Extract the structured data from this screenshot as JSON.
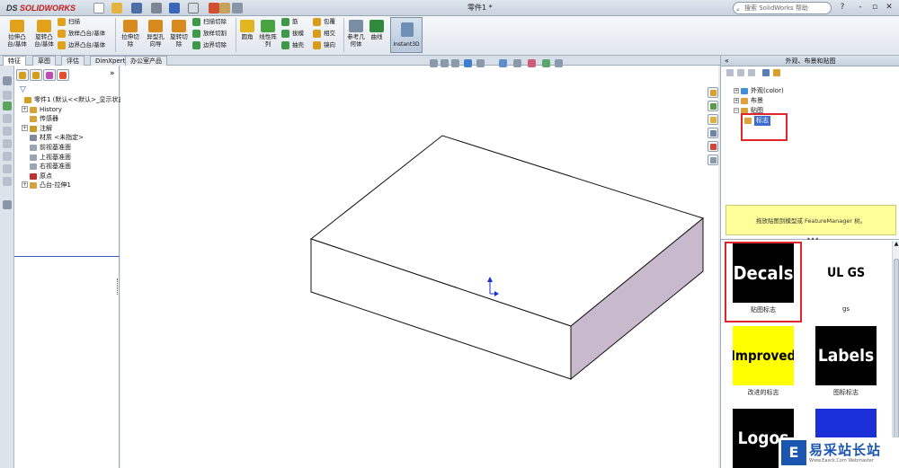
{
  "app": {
    "logo_prefix": "DS",
    "logo_text": "SOLIDWORKS",
    "document_title": "零件1 *",
    "search_placeholder": "搜索 SolidWorks 帮助",
    "window_buttons": [
      "?",
      "-",
      "▫",
      "✕"
    ]
  },
  "ribbon": {
    "big_buttons": [
      {
        "id": "extrude-boss",
        "label": "拉伸凸\n台/基体",
        "color": "#e0a21a"
      },
      {
        "id": "revolve-boss",
        "label": "旋转凸\n台/基体",
        "color": "#e0a21a"
      },
      {
        "id": "extrude-cut",
        "label": "拉伸切\n除",
        "color": "#d98a1c"
      },
      {
        "id": "hole-wizard",
        "label": "异型孔\n向导",
        "color": "#d98a1c"
      },
      {
        "id": "revolve-cut",
        "label": "旋转切\n除",
        "color": "#d98a1c"
      },
      {
        "id": "fillet",
        "label": "圆角",
        "color": "#e3b51e"
      },
      {
        "id": "linear-pattern",
        "label": "线性阵\n列",
        "color": "#49a340"
      },
      {
        "id": "ref-geometry",
        "label": "参考几\n何体",
        "color": "#7a8da3"
      },
      {
        "id": "curves",
        "label": "曲线",
        "color": "#2f8a3c"
      }
    ],
    "small_buttons": [
      {
        "id": "sweep",
        "label": "扫描",
        "color": "#e0a21a"
      },
      {
        "id": "loft-boss",
        "label": "放样凸台/基体",
        "color": "#e0a21a"
      },
      {
        "id": "boundary-boss",
        "label": "边界凸台/基体",
        "color": "#e0a21a"
      },
      {
        "id": "swept-cut",
        "label": "扫描切除",
        "color": "#3e9a48"
      },
      {
        "id": "lofted-cut",
        "label": "放样切割",
        "color": "#3e9a48"
      },
      {
        "id": "boundary-cut",
        "label": "边界切除",
        "color": "#3e9a48"
      },
      {
        "id": "rib",
        "label": "筋",
        "color": "#3e9a48"
      },
      {
        "id": "draft",
        "label": "拔模",
        "color": "#3e9a48"
      },
      {
        "id": "shell",
        "label": "抽壳",
        "color": "#3e9a48"
      },
      {
        "id": "wrap",
        "label": "包覆",
        "color": "#d99b1a"
      },
      {
        "id": "intersect",
        "label": "相交",
        "color": "#d99b1a"
      },
      {
        "id": "mirror",
        "label": "镜向",
        "color": "#d99b1a"
      }
    ],
    "instant3d_label": "Instant3D"
  },
  "tabs": [
    "特征",
    "草图",
    "评估",
    "DimXpert",
    "办公室产品"
  ],
  "feature_tree": [
    {
      "label": "零件1 (默认<<默认>_显示状态",
      "indent": 0,
      "expand": "",
      "color": "#d4a01c"
    },
    {
      "label": "History",
      "indent": 1,
      "expand": "+",
      "color": "#d8a23a"
    },
    {
      "label": "传感器",
      "indent": 1,
      "expand": "",
      "color": "#d8a23a"
    },
    {
      "label": "注解",
      "indent": 1,
      "expand": "+",
      "color": "#c89b28"
    },
    {
      "label": "材质 <未指定>",
      "indent": 1,
      "expand": "",
      "color": "#7f8aa0"
    },
    {
      "label": "前视基准面",
      "indent": 1,
      "expand": "",
      "color": "#9aa4b2"
    },
    {
      "label": "上视基准面",
      "indent": 1,
      "expand": "",
      "color": "#9aa4b2"
    },
    {
      "label": "右视基准面",
      "indent": 1,
      "expand": "",
      "color": "#9aa4b2"
    },
    {
      "label": "原点",
      "indent": 1,
      "expand": "",
      "color": "#c03030"
    },
    {
      "label": "凸台-拉伸1",
      "indent": 1,
      "expand": "+",
      "color": "#d8a23a"
    }
  ],
  "task_pane": {
    "title": "外观、布景和贴图",
    "tree": [
      {
        "label": "外观(color)",
        "expand": "+",
        "color": "#3f8fd8"
      },
      {
        "label": "布景",
        "expand": "+",
        "color": "#e0a040"
      },
      {
        "label": "贴图",
        "expand": "−",
        "color": "#d8a23a"
      }
    ],
    "selected_folder": "标志",
    "hint": "拖放贴图到模型或 FeatureManager 树。",
    "decals": [
      {
        "caption": "贴图标志",
        "thumb_text": "Decals",
        "bg": "#000000",
        "fg": "#ffffff"
      },
      {
        "caption": "gs",
        "thumb_text": "UL GS",
        "bg": "#ffffff",
        "fg": "#000000"
      },
      {
        "caption": "改进的标志",
        "thumb_text": "Improved",
        "bg": "#ffff00",
        "fg": "#000000"
      },
      {
        "caption": "图标标志",
        "thumb_text": "Labels",
        "bg": "#000000",
        "fg": "#ffffff"
      },
      {
        "caption": "",
        "thumb_text": "Logos",
        "bg": "#000000",
        "fg": "#ffffff"
      },
      {
        "caption": "",
        "thumb_text": "",
        "bg": "#1a2fd8",
        "fg": "#e02020"
      }
    ]
  },
  "watermark": {
    "brand": "易采站长站",
    "sub": "Www.Easck.Com  Webmaster",
    "mark": "E"
  },
  "colors": {
    "highlight_red": "#e0262b",
    "selection_blue": "#3a6bd0",
    "hint_yellow": "#ffff99",
    "box_side": "#c9b9cc"
  }
}
